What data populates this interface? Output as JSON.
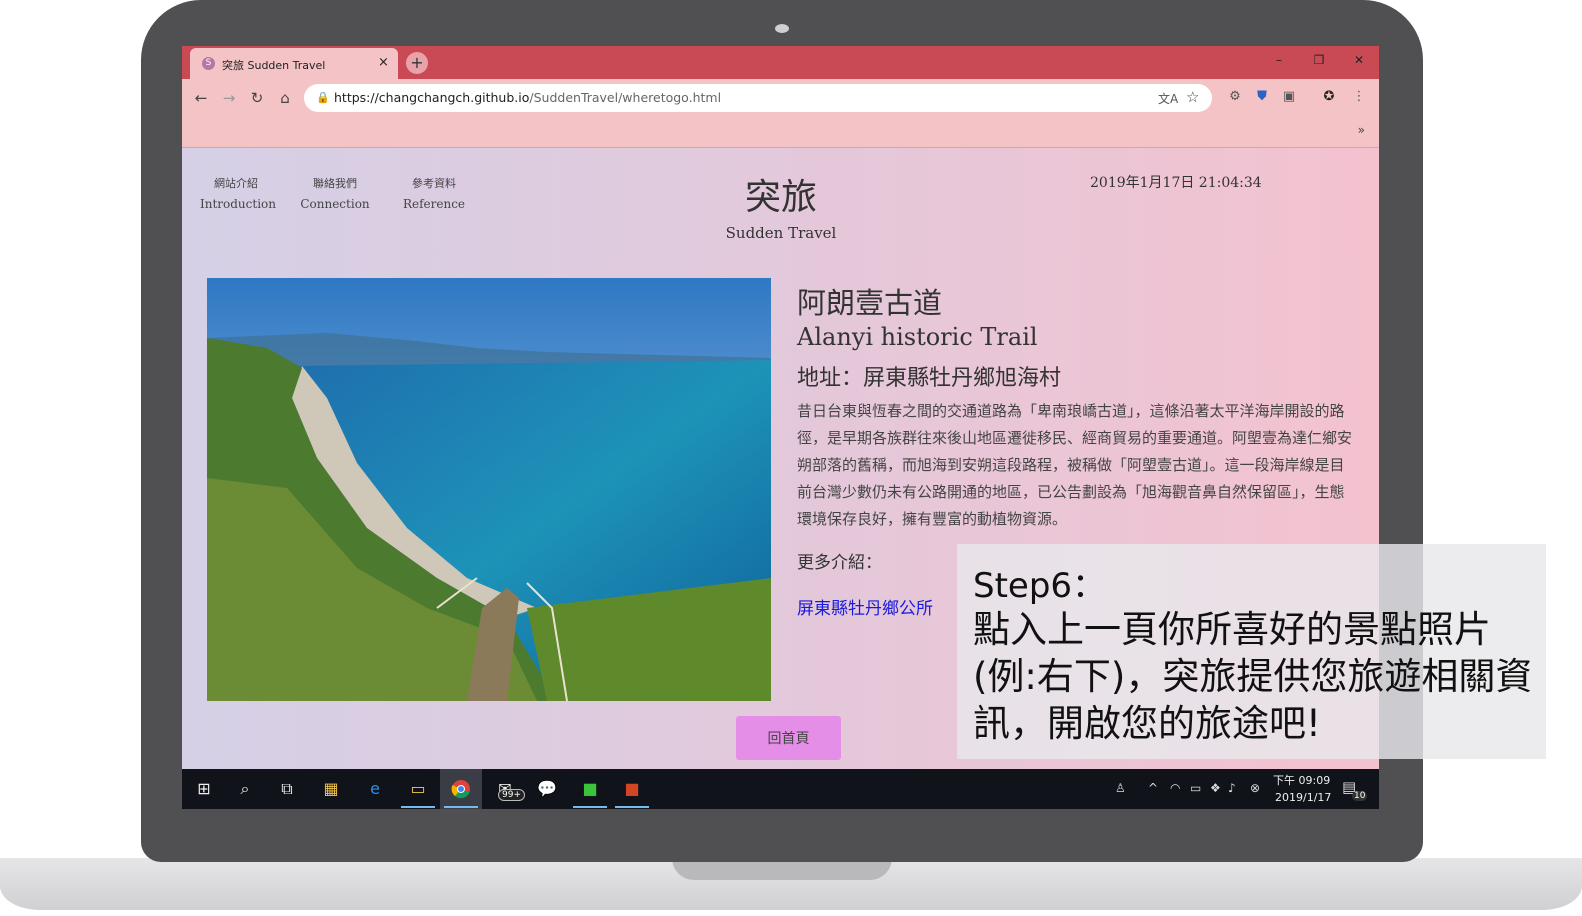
{
  "browser": {
    "tab_title": "突旅 Sudden Travel",
    "tab_close": "×",
    "new_tab": "+",
    "window_controls": {
      "minimize": "–",
      "maximize": "❐",
      "close": "✕"
    },
    "nav": {
      "back": "←",
      "forward": "→",
      "reload": "↻",
      "home": "⌂"
    },
    "url_host": "https://changchangch.github.io",
    "url_path": "/SuddenTravel/wheretogo.html",
    "bookmark_more": "»"
  },
  "page": {
    "nav_links": [
      {
        "zh": "網站介紹",
        "en": "Introduction"
      },
      {
        "zh": "聯絡我們",
        "en": "Connection"
      },
      {
        "zh": "參考資料",
        "en": "Reference"
      }
    ],
    "site_title": "突旅",
    "site_subtitle": "Sudden Travel",
    "datetime": "2019年1月17日 21:04:34",
    "spot": {
      "name_zh": "阿朗壹古道",
      "name_en": "Alanyi historic Trail",
      "address": "地址：屏東縣牡丹鄉旭海村",
      "description": "昔日台東與恆春之間的交通道路為「卑南琅嶠古道」，這條沿著太平洋海岸開設的路徑，是早期各族群往來後山地區遷徙移民、經商貿易的重要通道。阿塱壹為達仁鄉安朔部落的舊稱，而旭海到安朔這段路程，被稱做「阿塱壹古道」。這一段海岸線是目前台灣少數仍未有公路開通的地區，已公告劃設為「旭海觀音鼻自然保留區」，生態環境保存良好，擁有豐富的動植物資源。",
      "more_label": "更多介紹：",
      "more_link": "屏東縣牡丹鄉公所"
    },
    "home_button": "回首頁"
  },
  "taskbar": {
    "icons": [
      "windows-start-icon",
      "search-icon",
      "task-view-icon",
      "store-icon",
      "edge-icon",
      "file-explorer-icon",
      "chrome-icon",
      "mail-icon",
      "wechat-icon",
      "line-icon",
      "powerpoint-icon"
    ],
    "mail_badge": "99+",
    "clock_time": "下午 09:09",
    "clock_date": "2019/1/17",
    "notification_count": "10"
  },
  "instruction": {
    "step": "Step6：",
    "text": "點入上一頁你所喜好的景點照片(例:右下)，突旅提供您旅遊相關資訊，開啟您的旅途吧!"
  },
  "colors": {
    "tab_strip": "#c94a55",
    "toolbar": "#f4c3c6",
    "page_gradient_left": "#d5d0e6",
    "page_gradient_right": "#f4c2cf",
    "home_button": "#e58ee8",
    "link": "#1a1adb"
  }
}
